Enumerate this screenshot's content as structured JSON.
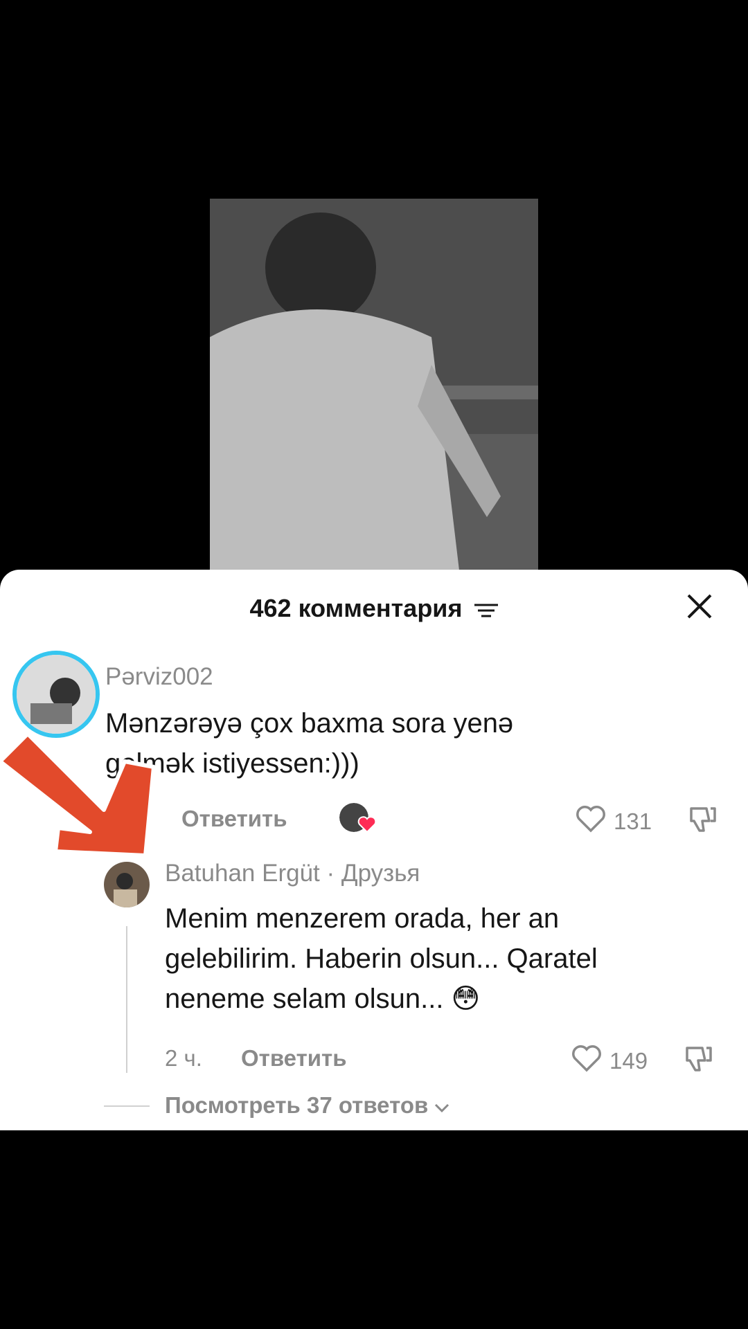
{
  "header": {
    "title": "462 комментария"
  },
  "comments": [
    {
      "username": "Pərviz002",
      "text_line1": "Mənzərəyə çox baxma sora yenə",
      "text_line2": "gelmək istiyessen:)))",
      "reply_label": "Ответить",
      "likes": "131"
    },
    {
      "username": "Batuhan Ergüt · Друзья",
      "text_line1": "Menim menzerem orada, her an",
      "text_line2": "gelebilirim. Haberin olsun... Qaratel",
      "text_line3": "neneme selam olsun... 😳",
      "time": "2 ч.",
      "reply_label": "Ответить",
      "likes": "149"
    }
  ],
  "view_replies": "Посмотреть 37 ответов",
  "colors": {
    "accent_arrow": "#e24a2b",
    "ring": "#36c6f0",
    "heart_badge": "#fe2c55"
  }
}
